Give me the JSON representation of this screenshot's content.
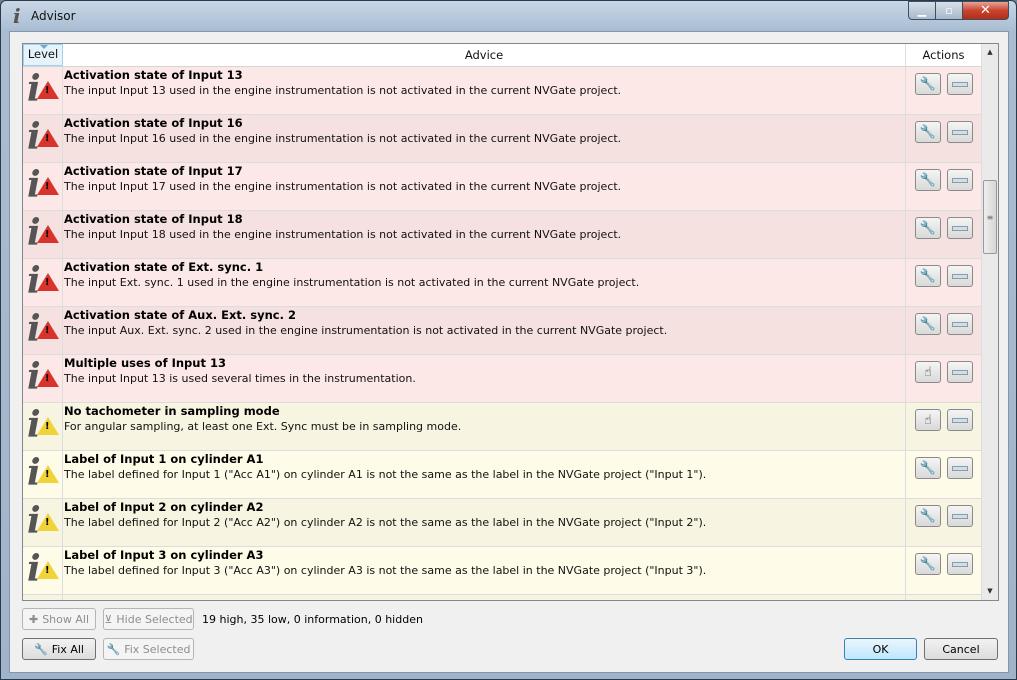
{
  "window": {
    "title": "Advisor",
    "icon": "info-icon"
  },
  "table": {
    "headers": {
      "level": "Level",
      "advice": "Advice",
      "actions": "Actions"
    },
    "rows": [
      {
        "level": "high",
        "title": "Activation state of Input 13",
        "desc": "The input Input 13 used in the engine instrumentation is not activated in the current NVGate project.",
        "fix_enabled": true
      },
      {
        "level": "high",
        "title": "Activation state of Input 16",
        "desc": "The input Input 16 used in the engine instrumentation is not activated in the current NVGate project.",
        "fix_enabled": true
      },
      {
        "level": "high",
        "title": "Activation state of Input 17",
        "desc": "The input Input 17 used in the engine instrumentation is not activated in the current NVGate project.",
        "fix_enabled": true
      },
      {
        "level": "high",
        "title": "Activation state of Input 18",
        "desc": "The input Input 18 used in the engine instrumentation is not activated in the current NVGate project.",
        "fix_enabled": true
      },
      {
        "level": "high",
        "title": "Activation state of Ext. sync. 1",
        "desc": "The input Ext. sync. 1 used in the engine instrumentation is not activated in the current NVGate project.",
        "fix_enabled": true
      },
      {
        "level": "high",
        "title": "Activation state of Aux. Ext. sync. 2",
        "desc": "The input Aux. Ext. sync. 2 used in the engine instrumentation is not activated in the current NVGate project.",
        "fix_enabled": true
      },
      {
        "level": "high",
        "title": "Multiple uses of Input 13",
        "desc": "The input Input 13 is used several times in the instrumentation.",
        "fix_enabled": false
      },
      {
        "level": "low",
        "title": "No tachometer in sampling mode",
        "desc": "For angular sampling, at least one Ext. Sync must be in sampling mode.",
        "fix_enabled": false
      },
      {
        "level": "low",
        "title": "Label of Input 1 on cylinder A1",
        "desc": "The label defined for Input 1 (\"Acc A1\") on cylinder A1 is not the same as the label in the NVGate project (\"Input 1\").",
        "fix_enabled": true
      },
      {
        "level": "low",
        "title": "Label of Input 2 on cylinder A2",
        "desc": "The label defined for Input 2 (\"Acc A2\") on cylinder A2 is not the same as the label in the NVGate project (\"Input 2\").",
        "fix_enabled": true
      },
      {
        "level": "low",
        "title": "Label of Input 3 on cylinder A3",
        "desc": "The label defined for Input 3 (\"Acc A3\") on cylinder A3 is not the same as the label in the NVGate project (\"Input 3\").",
        "fix_enabled": true
      }
    ],
    "scroll_position_percent": 25
  },
  "colors": {
    "high": "#fde8e8",
    "low": "#fefce8",
    "warning_high": "#d9342b",
    "warning_low": "#f0d23a"
  },
  "buttons": {
    "show_all": "Show All",
    "hide_selected": "Hide Selected",
    "fix_all": "Fix All",
    "fix_selected": "Fix Selected",
    "ok": "OK",
    "cancel": "Cancel"
  },
  "status": "19 high, 35 low, 0 information, 0 hidden"
}
